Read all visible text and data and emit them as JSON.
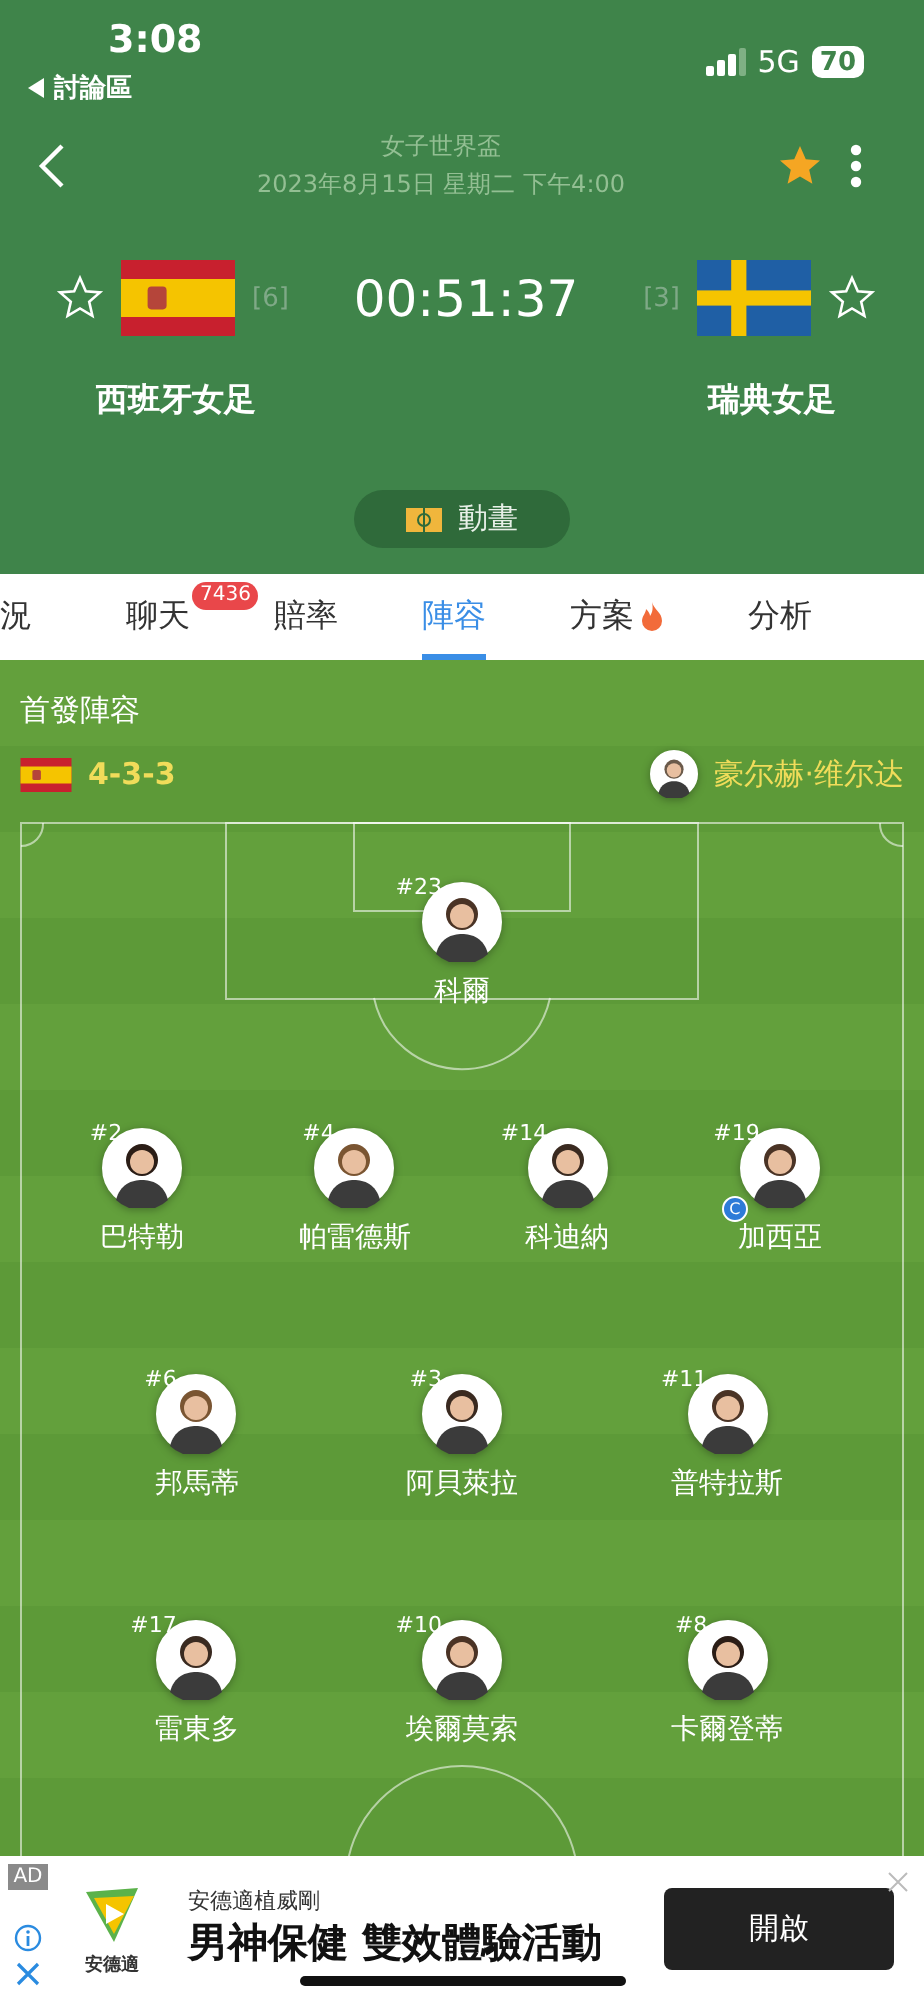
{
  "status_bar": {
    "time": "3:08",
    "back_label": "討論區",
    "network": "5G",
    "battery": "70"
  },
  "header": {
    "competition": "女子世界盃",
    "datetime": "2023年8月15日 星期二 下午4:00",
    "favorite": true
  },
  "match": {
    "home": {
      "name": "西班牙女足",
      "rank": "[6]",
      "favorite": false
    },
    "away": {
      "name": "瑞典女足",
      "rank": "[3]",
      "favorite": false
    },
    "clock": "00:51:37",
    "animation_button": "動畫"
  },
  "tabs": [
    {
      "label": "況",
      "selected": false,
      "hot": false
    },
    {
      "label": "聊天",
      "selected": false,
      "hot": false,
      "badge": "7436"
    },
    {
      "label": "賠率",
      "selected": false,
      "hot": false
    },
    {
      "label": "陣容",
      "selected": true,
      "hot": false
    },
    {
      "label": "方案",
      "selected": false,
      "hot": true
    },
    {
      "label": "分析",
      "selected": false,
      "hot": false
    }
  ],
  "lineup": {
    "title": "首發陣容",
    "formation": "4-3-3",
    "coach": "豪尔赫·维尔达",
    "captain_label": "C",
    "lines": [
      [
        {
          "number": "#23",
          "name": "科爾",
          "captain": false
        }
      ],
      [
        {
          "number": "#2",
          "name": "巴特勒",
          "captain": false
        },
        {
          "number": "#4",
          "name": "帕雷德斯",
          "captain": false
        },
        {
          "number": "#14",
          "name": "科迪納",
          "captain": false
        },
        {
          "number": "#19",
          "name": "加西亞",
          "captain": true
        }
      ],
      [
        {
          "number": "#6",
          "name": "邦馬蒂",
          "captain": false
        },
        {
          "number": "#3",
          "name": "阿貝萊拉",
          "captain": false
        },
        {
          "number": "#11",
          "name": "普特拉斯",
          "captain": false
        }
      ],
      [
        {
          "number": "#17",
          "name": "雷東多",
          "captain": false
        },
        {
          "number": "#10",
          "name": "埃爾莫索",
          "captain": false
        },
        {
          "number": "#8",
          "name": "卡爾登蒂",
          "captain": false
        }
      ]
    ]
  },
  "ad": {
    "tag": "AD",
    "brand": "安德適",
    "advertiser": "安德適植威剛",
    "headline": "男神保健 雙效體驗活動",
    "button": "開啟"
  }
}
